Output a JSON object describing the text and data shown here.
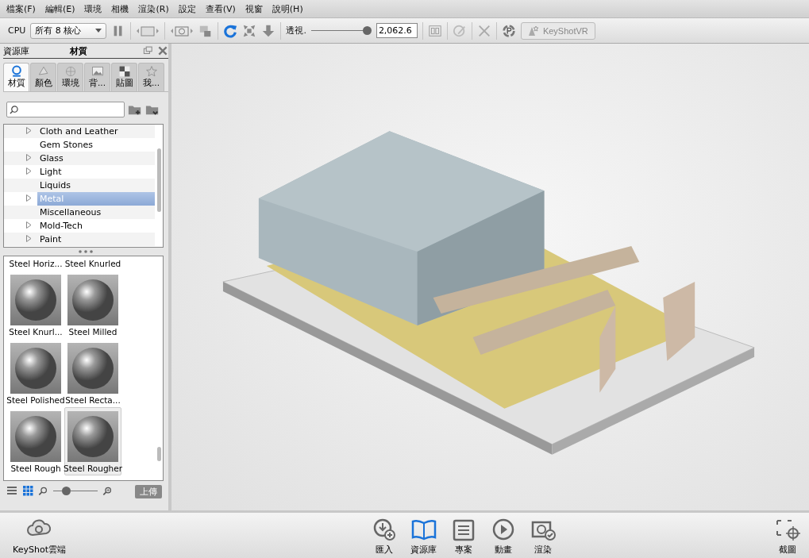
{
  "menu": [
    "檔案(F)",
    "編輯(E)",
    "環境",
    "相機",
    "渲染(R)",
    "設定",
    "查看(V)",
    "視窗",
    "說明(H)"
  ],
  "toolbar": {
    "cpu_label": "CPU",
    "cpu_select": "所有 8 核心",
    "perspective_label": "透視.",
    "perspective_slider": {
      "level": 0.93
    },
    "perspective_value": "2,062.6",
    "vr_button": "KeyShotVR"
  },
  "panel": {
    "title": "資源庫",
    "subtitle": "材質",
    "tabs": [
      {
        "label": "材質",
        "selected": true
      },
      {
        "label": "顏色",
        "selected": false
      },
      {
        "label": "環境",
        "selected": false
      },
      {
        "label": "背...",
        "selected": false
      },
      {
        "label": "貼圖",
        "selected": false
      },
      {
        "label": "我...",
        "selected": false
      }
    ],
    "tree": [
      {
        "label": "Cloth and Leather",
        "expandable": true,
        "selected": false
      },
      {
        "label": "Gem Stones",
        "expandable": false,
        "selected": false
      },
      {
        "label": "Glass",
        "expandable": true,
        "selected": false
      },
      {
        "label": "Light",
        "expandable": true,
        "selected": false
      },
      {
        "label": "Liquids",
        "expandable": false,
        "selected": false
      },
      {
        "label": "Metal",
        "expandable": true,
        "selected": true
      },
      {
        "label": "Miscellaneous",
        "expandable": false,
        "selected": false
      },
      {
        "label": "Mold-Tech",
        "expandable": true,
        "selected": false
      },
      {
        "label": "Paint",
        "expandable": true,
        "selected": false
      }
    ],
    "thumbnails": [
      {
        "label": "Steel Horiz...",
        "kind": "partial",
        "selected": false
      },
      {
        "label": "Steel Knurled",
        "kind": "partial",
        "selected": false
      },
      {
        "label": "Steel Knurl...",
        "kind": "full",
        "selected": false
      },
      {
        "label": "Steel Milled",
        "kind": "full",
        "selected": false
      },
      {
        "label": "Steel Polished",
        "kind": "full",
        "selected": false
      },
      {
        "label": "Steel Recta...",
        "kind": "full",
        "selected": false
      },
      {
        "label": "Steel Rough",
        "kind": "full",
        "selected": false
      },
      {
        "label": "Steel Rougher",
        "kind": "full",
        "selected": true
      }
    ],
    "views": [
      {
        "kind": "list",
        "selected": false
      },
      {
        "kind": "grid",
        "selected": true
      }
    ],
    "zoom_slider": {
      "level": 0.3
    },
    "upload_button": "上傳"
  },
  "bottom_bar": {
    "cloud": "KeyShot雲端",
    "buttons": [
      {
        "label": "匯入",
        "kind": "import",
        "selected": false
      },
      {
        "label": "資源庫",
        "kind": "library",
        "selected": true
      },
      {
        "label": "專案",
        "kind": "project",
        "selected": false
      },
      {
        "label": "動畫",
        "kind": "animation",
        "selected": false
      },
      {
        "label": "渲染",
        "kind": "render",
        "selected": false
      }
    ],
    "screenshot": "截圖"
  }
}
